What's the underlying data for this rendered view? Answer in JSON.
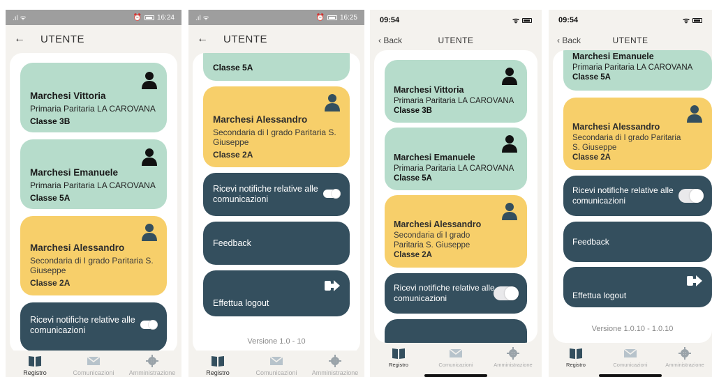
{
  "colors": {
    "green_card": "#b6dccb",
    "yellow_card": "#f7cf6a",
    "dark_card": "#344f5e",
    "background": "#f4f2ee"
  },
  "screens": [
    {
      "status": {
        "time": "16:24"
      },
      "header": {
        "back": "←",
        "title": "UTENTE"
      },
      "students": [
        {
          "name": "Marchesi Vittoria",
          "school": "Primaria Paritaria LA CAROVANA",
          "classe": "Classe 3B"
        },
        {
          "name": "Marchesi Emanuele",
          "school": "Primaria Paritaria LA CAROVANA",
          "classe": "Classe 5A"
        },
        {
          "name": "Marchesi Alessandro",
          "school": "Secondaria di I grado Paritaria  S. Giuseppe",
          "classe": "Classe 2A"
        }
      ],
      "notifications_label": "Ricevi notifiche relative alle comunicazioni",
      "tabs": [
        "Registro",
        "Comunicazioni",
        "Amministrazione"
      ]
    },
    {
      "status": {
        "time": "16:25"
      },
      "header": {
        "back": "←",
        "title": "UTENTE"
      },
      "partial_classe": "Classe 5A",
      "student": {
        "name": "Marchesi Alessandro",
        "school": "Secondaria di I grado Paritaria  S. Giuseppe",
        "classe": "Classe 2A"
      },
      "notifications_label": "Ricevi notifiche relative alle comunicazioni",
      "feedback_label": "Feedback",
      "logout_label": "Effettua logout",
      "version": "Versione 1.0 - 10",
      "tabs": [
        "Registro",
        "Comunicazioni",
        "Amministrazione"
      ]
    },
    {
      "status": {
        "time": "09:54"
      },
      "header": {
        "back": "Back",
        "title": "UTENTE"
      },
      "students": [
        {
          "name": "Marchesi Vittoria",
          "school": "Primaria Paritaria LA CAROVANA",
          "classe": "Classe 3B"
        },
        {
          "name": "Marchesi Emanuele",
          "school": "Primaria Paritaria LA CAROVANA",
          "classe": "Classe 5A"
        },
        {
          "name": "Marchesi Alessandro",
          "school": "Secondaria di I grado Paritaria S. Giuseppe",
          "classe": "Classe 2A"
        }
      ],
      "notifications_label": "Ricevi notifiche relative alle comunicazioni",
      "tabs": [
        "Registro",
        "Comunicazioni",
        "Amministrazione"
      ]
    },
    {
      "status": {
        "time": "09:54"
      },
      "header": {
        "back": "Back",
        "title": "UTENTE"
      },
      "partial_name": "Marchesi Emanuele",
      "partial_school": "Primaria Paritaria LA CAROVANA",
      "partial_classe": "Classe 5A",
      "student": {
        "name": "Marchesi Alessandro",
        "school": "Secondaria di I grado Paritaria S. Giuseppe",
        "classe": "Classe 2A"
      },
      "notifications_label": "Ricevi notifiche relative alle comunicazioni",
      "feedback_label": "Feedback",
      "logout_label": "Effettua logout",
      "version": "Versione 1.0.10 - 1.0.10",
      "tabs": [
        "Registro",
        "Comunicazioni",
        "Amministrazione"
      ]
    }
  ]
}
